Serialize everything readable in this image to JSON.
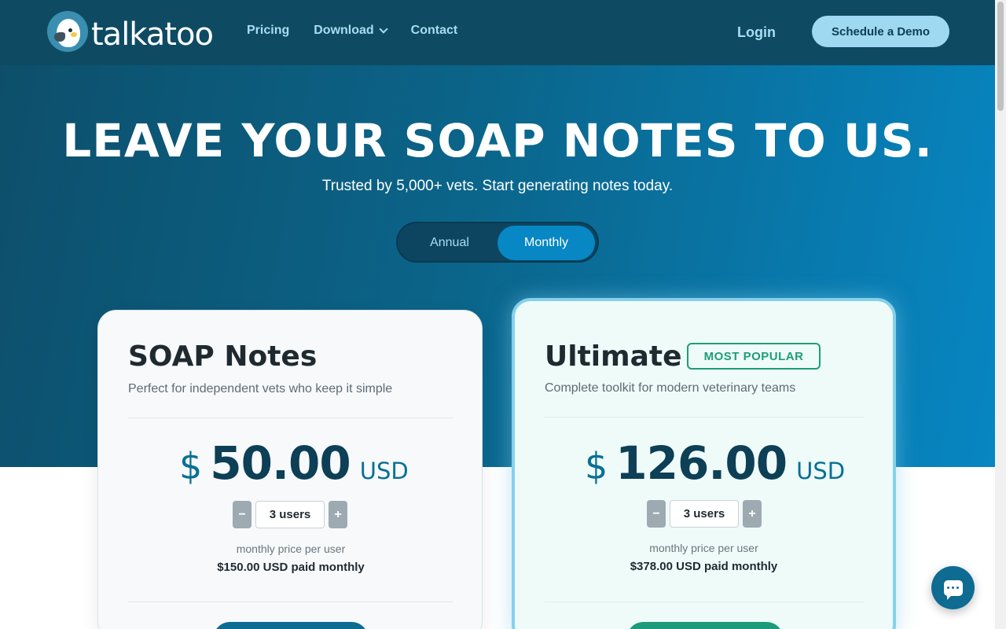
{
  "brand": {
    "name": "talkatoo"
  },
  "nav": {
    "links": [
      {
        "label": "Pricing"
      },
      {
        "label": "Download"
      },
      {
        "label": "Contact"
      }
    ],
    "login": "Login",
    "demo": "Schedule a Demo"
  },
  "hero": {
    "title": "LEAVE YOUR SOAP NOTES TO US.",
    "subtitle": "Trusted by 5,000+ vets. Start generating notes today."
  },
  "billing_toggle": {
    "options": [
      "Annual",
      "Monthly"
    ],
    "selected": "Monthly"
  },
  "plans": [
    {
      "name": "SOAP Notes",
      "description": "Perfect for independent vets who keep it simple",
      "currency_symbol": "$",
      "price": "50.00",
      "currency": "USD",
      "users": "3 users",
      "per_user_label": "monthly price per user",
      "total": "$150.00 USD paid monthly"
    },
    {
      "name": "Ultimate",
      "badge": "MOST POPULAR",
      "description": "Complete toolkit for modern veterinary teams",
      "currency_symbol": "$",
      "price": "126.00",
      "currency": "USD",
      "users": "3 users",
      "per_user_label": "monthly price per user",
      "total": "$378.00 USD paid monthly"
    }
  ],
  "stepper": {
    "minus": "−",
    "plus": "+"
  },
  "icons": {
    "chat": "chat-icon",
    "chevron": "chevron-down-icon",
    "logo": "cockatoo-logo-icon"
  },
  "colors": {
    "nav_bg": "#0e4b63",
    "accent_blue": "#0787c3",
    "badge_green": "#1e9e73",
    "price_dark": "#0d3f56"
  }
}
